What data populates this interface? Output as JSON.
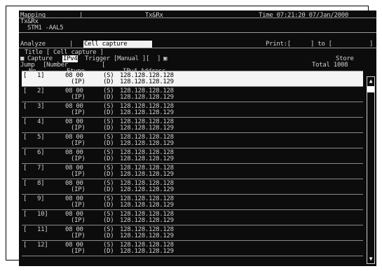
{
  "header": {
    "mapping": "Mapping",
    "mode": "Tx&Rx",
    "time": "Time 07:21:20 07/Jan/2000",
    "direction": "Tx&Rx",
    "stm": "STM1 -AAL5"
  },
  "menu": {
    "analyze": "Analyze",
    "cell_capture": "Cell capture",
    "print_label": "Print:[",
    "print_to": "] to [",
    "print_end": "]"
  },
  "settings": {
    "title": "Title [ Cell capture ]",
    "capture_label": "Capture",
    "capture_value": "IPv4",
    "trigger": "Trigger [Manual ][",
    "trigger_end": "]",
    "jump": "Jump",
    "number": "[Number",
    "number_bracket": "[",
    "store_button": "Store",
    "total": "Total 1008"
  },
  "table": {
    "columns": [
      "No.",
      "Etype",
      "IPv4 Address"
    ],
    "rows": [
      {
        "no": "1]",
        "etype": "08 00",
        "etype_sub": "(IP)",
        "dir_s": "(S)",
        "addr_s": "128.128.128.128",
        "dir_d": "(D)",
        "addr_d": "128.128.128.129",
        "selected": true
      },
      {
        "no": "2]",
        "etype": "08 00",
        "etype_sub": "(IP)",
        "dir_s": "(S)",
        "addr_s": "128.128.128.128",
        "dir_d": "(D)",
        "addr_d": "128.128.128.129",
        "selected": false
      },
      {
        "no": "3]",
        "etype": "08 00",
        "etype_sub": "(IP)",
        "dir_s": "(S)",
        "addr_s": "128.128.128.128",
        "dir_d": "(D)",
        "addr_d": "128.128.128.129",
        "selected": false
      },
      {
        "no": "4]",
        "etype": "08 00",
        "etype_sub": "(IP)",
        "dir_s": "(S)",
        "addr_s": "128.128.128.128",
        "dir_d": "(D)",
        "addr_d": "128.128.128.129",
        "selected": false
      },
      {
        "no": "5]",
        "etype": "08 00",
        "etype_sub": "(IP)",
        "dir_s": "(S)",
        "addr_s": "128.128.128.128",
        "dir_d": "(D)",
        "addr_d": "128.128.128.129",
        "selected": false
      },
      {
        "no": "6]",
        "etype": "08 00",
        "etype_sub": "(IP)",
        "dir_s": "(S)",
        "addr_s": "128.128.128.128",
        "dir_d": "(D)",
        "addr_d": "128.128.128.129",
        "selected": false
      },
      {
        "no": "7]",
        "etype": "08 00",
        "etype_sub": "(IP)",
        "dir_s": "(S)",
        "addr_s": "128.128.128.128",
        "dir_d": "(D)",
        "addr_d": "128.128.128.129",
        "selected": false
      },
      {
        "no": "8]",
        "etype": "08 00",
        "etype_sub": "(IP)",
        "dir_s": "(S)",
        "addr_s": "128.128.128.128",
        "dir_d": "(D)",
        "addr_d": "128.128.128.129",
        "selected": false
      },
      {
        "no": "9]",
        "etype": "08 00",
        "etype_sub": "(IP)",
        "dir_s": "(S)",
        "addr_s": "128.128.128.128",
        "dir_d": "(D)",
        "addr_d": "128.128.128.129",
        "selected": false
      },
      {
        "no": "10]",
        "etype": "08 00",
        "etype_sub": "(IP)",
        "dir_s": "(S)",
        "addr_s": "128.128.128.128",
        "dir_d": "(D)",
        "addr_d": "128.128.128.129",
        "selected": false
      },
      {
        "no": "11]",
        "etype": "08 00",
        "etype_sub": "(IP)",
        "dir_s": "(S)",
        "addr_s": "128.128.128.128",
        "dir_d": "(D)",
        "addr_d": "128.128.128.129",
        "selected": false
      },
      {
        "no": "12]",
        "etype": "08 00",
        "etype_sub": "(IP)",
        "dir_s": "(S)",
        "addr_s": "128.128.128.128",
        "dir_d": "(D)",
        "addr_d": "128.128.128.129",
        "selected": false
      }
    ]
  },
  "icons": {
    "scroll_up": "scroll-up-icon",
    "scroll_down": "scroll-down-icon",
    "capture_checkbox": "checkbox-icon"
  },
  "colors": {
    "screen_bg": "#0c0c0c",
    "text": "#d0d0d0",
    "highlight": "#f2f2f2"
  }
}
